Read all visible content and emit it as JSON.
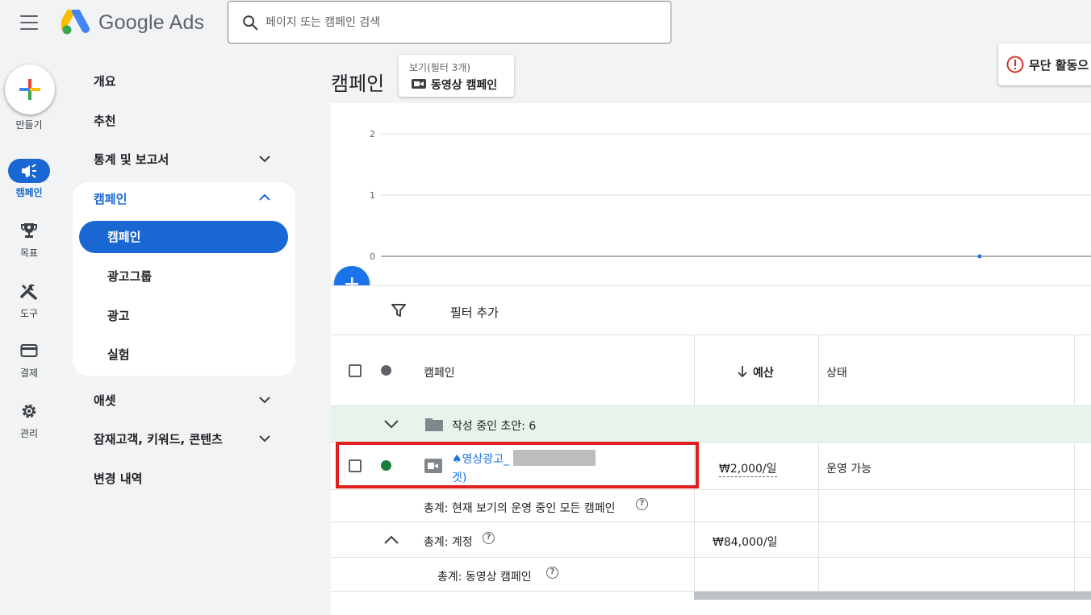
{
  "header": {
    "app_name": "Google Ads",
    "search_placeholder": "페이지 또는 캠페인 검색"
  },
  "rail": {
    "create_label": "만들기",
    "items": [
      {
        "label": "캠페인",
        "icon": "megaphone-icon",
        "active": true
      },
      {
        "label": "목표",
        "icon": "trophy-icon"
      },
      {
        "label": "도구",
        "icon": "tools-icon"
      },
      {
        "label": "결제",
        "icon": "credit-card-icon"
      },
      {
        "label": "관리",
        "icon": "gear-icon"
      }
    ]
  },
  "nav": {
    "overview": "개요",
    "recommendations": "추천",
    "insights_reports": "통계 및 보고서",
    "campaigns_group": {
      "title": "캠페인",
      "items": [
        "캠페인",
        "광고그룹",
        "광고",
        "실험"
      ],
      "active": "캠페인"
    },
    "assets": "애셋",
    "audiences": "잠재고객, 키워드, 콘텐츠",
    "change_history": "변경 내역"
  },
  "main": {
    "title": "캠페인",
    "view_chip": {
      "line1": "보기(필터 3개)",
      "line2": "동영상 캠페인"
    },
    "alert": "무단 활동으"
  },
  "chart_data": {
    "type": "line",
    "yticks": [
      "2",
      "1",
      "0"
    ],
    "ylim": [
      0,
      2
    ],
    "series": [
      {
        "values": [
          0
        ]
      }
    ],
    "grid": true,
    "colors": {
      "line": "#1a73e8"
    }
  },
  "filter": {
    "label": "필터 추가"
  },
  "table": {
    "columns": {
      "campaign": "캠페인",
      "budget": "예산",
      "status": "상태"
    },
    "draft_row": "작성 중인 초안: 6",
    "campaign_row": {
      "name_line1": "♠영상광고_",
      "name_line2": "겟)",
      "budget": "₩2,000/일",
      "status": "운영 가능",
      "status_color": "#188038"
    },
    "total_view": "총계: 현재 보기의 운영 중인 모든 캠페인",
    "total_account": {
      "label": "총계: 계정",
      "budget": "₩84,000/일"
    },
    "total_video": "총계: 동영상 캠페인"
  }
}
